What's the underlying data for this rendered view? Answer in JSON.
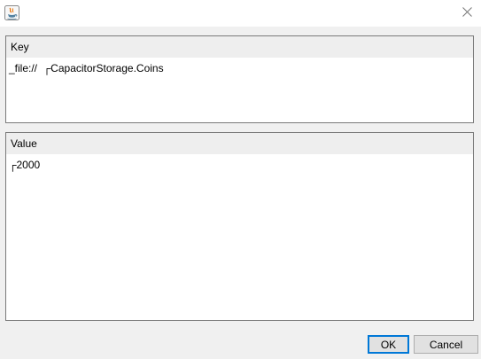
{
  "window": {
    "icon": "java-app-icon",
    "close_icon": "close-icon"
  },
  "key_panel": {
    "header": "Key",
    "value": "_file://  ┌CapacitorStorage.Coins"
  },
  "value_panel": {
    "header": "Value",
    "value": "┌2000"
  },
  "buttons": {
    "ok": "OK",
    "cancel": "Cancel"
  },
  "colors": {
    "accent": "#0078d7",
    "background": "#f0f0f0",
    "header": "#eeeeee"
  }
}
